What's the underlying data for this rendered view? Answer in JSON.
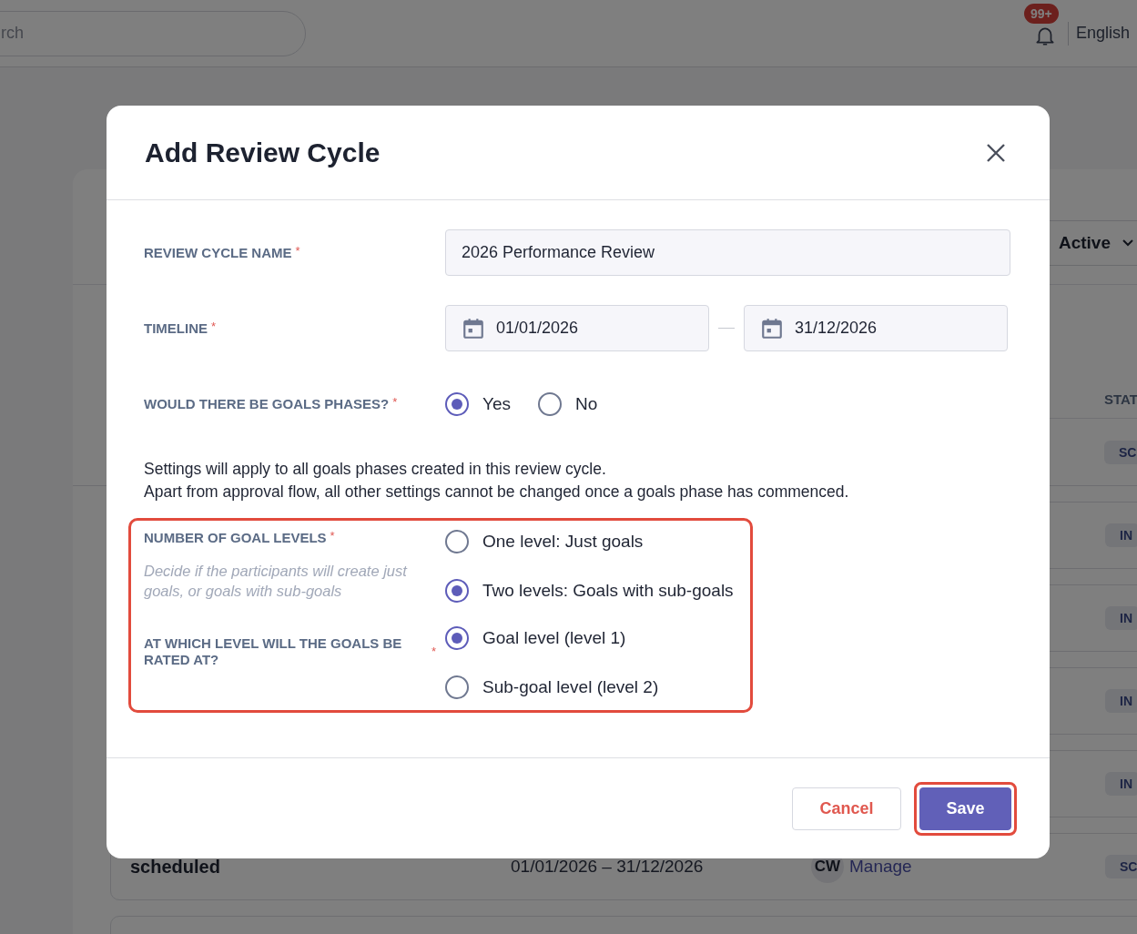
{
  "background": {
    "search": {
      "placeholder": "rch"
    },
    "notifications": {
      "badge": "99+"
    },
    "language": "English",
    "filter": {
      "value": "Active"
    },
    "table": {
      "columns": [
        "STAT"
      ],
      "rows": [
        {
          "status": "SC"
        },
        {
          "status": "IN"
        },
        {
          "status": "IN"
        },
        {
          "status": "IN"
        },
        {
          "status": "IN"
        },
        {
          "name": "scheduled",
          "timeline": "01/01/2026 – 31/12/2026",
          "owner": "CW",
          "action": "Manage",
          "status": "SC"
        }
      ]
    }
  },
  "modal": {
    "title": "Add Review Cycle",
    "fields": [
      {
        "kind": "text",
        "label": "REVIEW CYCLE NAME",
        "required_mark": "*",
        "value": "2026 Performance Review"
      },
      {
        "kind": "daterange",
        "label": "TIMELINE",
        "required_mark": "*",
        "start": "01/01/2026",
        "end": "31/12/2026"
      },
      {
        "kind": "radio",
        "label": "WOULD THERE BE GOALS PHASES?",
        "required_mark": "*",
        "options": [
          {
            "label": "Yes",
            "selected": true
          },
          {
            "label": "No",
            "selected": false
          }
        ]
      }
    ],
    "note": [
      "Settings will apply to all goals phases created in this review cycle.",
      "Apart from approval flow, all other settings cannot be changed once a goals phase has commenced."
    ],
    "goal_settings": {
      "highlighted": true,
      "groups": [
        {
          "label": "NUMBER OF GOAL LEVELS",
          "required_mark": "*",
          "hint": "Decide if the participants will create just goals, or goals with sub-goals",
          "options": [
            {
              "label": "One level: Just goals",
              "selected": false
            },
            {
              "label": "Two levels: Goals with sub-goals",
              "selected": true
            }
          ]
        },
        {
          "label": "AT WHICH LEVEL WILL THE GOALS BE RATED AT?",
          "required_mark": "*",
          "options": [
            {
              "label": "Goal level (level 1)",
              "selected": true
            },
            {
              "label": "Sub-goal level (level 2)",
              "selected": false
            }
          ]
        }
      ]
    },
    "buttons": [
      {
        "kind": "secondary",
        "label": "Cancel",
        "highlighted": false
      },
      {
        "kind": "primary",
        "label": "Save",
        "highlighted": true
      }
    ]
  }
}
